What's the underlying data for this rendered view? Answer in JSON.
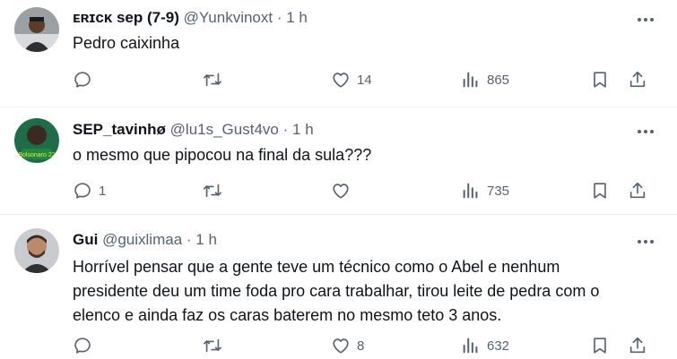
{
  "tweets": [
    {
      "name": "ᴇʀɪᴄᴋ sep (7-9)",
      "handle": "@Yunkvinoxt",
      "dot": "·",
      "time": "1 h",
      "text": "Pedro caixinha",
      "replies": "",
      "retweets": "",
      "likes": "14",
      "views": "865"
    },
    {
      "name": "SEP_tavinhø",
      "handle": "@lu1s_Gust4vo",
      "dot": "·",
      "time": "1 h",
      "text": "o mesmo que pipocou na final da sula???",
      "replies": "1",
      "retweets": "",
      "likes": "",
      "views": "735",
      "avatar_badge": "Bolsonaro 22"
    },
    {
      "name": "Gui",
      "handle": "@guixlimaa",
      "dot": "·",
      "time": "1 h",
      "text": "Horrível pensar que a gente teve um técnico como o Abel e nenhum\npresidente deu um time foda pro cara trabalhar, tirou leite de pedra com o\nelenco e ainda faz os caras baterem no mesmo teto 3 anos.",
      "replies": "",
      "retweets": "",
      "likes": "8",
      "views": "632"
    }
  ],
  "icons": {
    "reply": "reply-icon",
    "retweet": "retweet-icon",
    "like": "like-icon",
    "views": "views-icon",
    "bookmark": "bookmark-icon",
    "share": "share-icon",
    "more": "more-icon"
  },
  "colors": {
    "text": "#0f1419",
    "muted": "#536471",
    "divider": "#eff3f4"
  }
}
